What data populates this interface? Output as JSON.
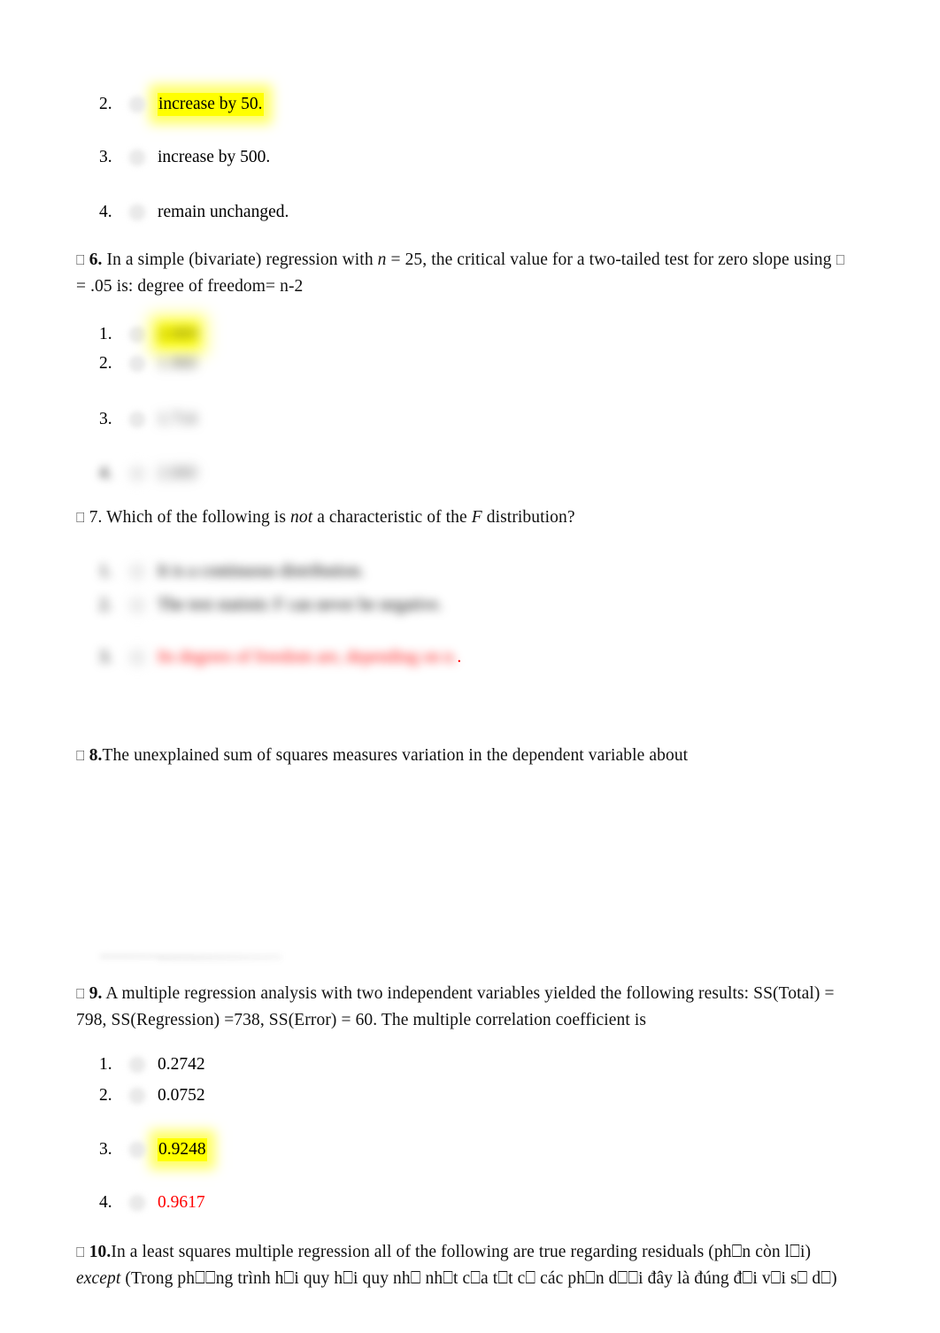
{
  "document": {
    "type": "quiz-worksheet",
    "highlight_color": "#FFFF00",
    "answer_red_color": "#FF0000",
    "tofu_glyph": "⎕"
  },
  "q5_options": {
    "items": [
      {
        "num": "2.",
        "label": "increase by 50.",
        "highlighted": true,
        "redacted": false
      },
      {
        "num": "3.",
        "label": "increase by 500.",
        "highlighted": false,
        "redacted": false
      },
      {
        "num": "4.",
        "label": "remain unchanged.",
        "highlighted": false,
        "redacted": false
      }
    ]
  },
  "q6": {
    "bullet": "⎕",
    "number": "6.",
    "text_part1": " In a simple (bivariate) regression with ",
    "italic_n": "n",
    "text_part2": " = 25, the critical value for a two-tailed test for zero slope using ",
    "alpha_glyph": "⎕",
    "text_line2": " = .05 is: degree of freedom= n-2",
    "options": [
      {
        "num": "1.",
        "label": "2.069",
        "highlighted": true,
        "redacted": true
      },
      {
        "num": "2.",
        "label": "1.960",
        "highlighted": false,
        "redacted": true
      },
      {
        "num": "3.",
        "label": "1.714",
        "highlighted": false,
        "redacted": true
      },
      {
        "num": "4.",
        "label": "2.060",
        "highlighted": false,
        "redacted": true
      }
    ]
  },
  "q7": {
    "bullet": "⎕",
    "number": "7.",
    "text_part1": " Which of the following is ",
    "italic_not": "not",
    "text_part2": " a characteristic of the ",
    "italic_F": "F",
    "text_part3": " distribution?",
    "options": [
      {
        "num": "1.",
        "label": "It is a continuous distribution.",
        "redacted": true,
        "red": false
      },
      {
        "num": "2.",
        "label": "The test statistic F can never be negative.",
        "redacted": true,
        "red": false
      },
      {
        "num": "3.",
        "label": "Its degrees of freedom are, depending on n.",
        "redacted": true,
        "red": true,
        "trailing_period": "."
      }
    ]
  },
  "q8": {
    "bullet": "⎕",
    "number": "8.",
    "text": "The unexplained sum of squares measures variation in the dependent variable about"
  },
  "q9": {
    "bullet": "⎕",
    "number": "9.",
    "text_line1": " A multiple regression analysis with two independent variables yielded the following results: SS(Total) =",
    "text_line2": "798, SS(Regression) =738, SS(Error) = 60. The multiple correlation coefficient is",
    "options": [
      {
        "num": "1.",
        "label": "0.2742",
        "highlighted": false,
        "red": false
      },
      {
        "num": "2.",
        "label": "0.0752",
        "highlighted": false,
        "red": false
      },
      {
        "num": "3.",
        "label": "0.9248",
        "highlighted": true,
        "red": false
      },
      {
        "num": "4.",
        "label": "0.9617",
        "highlighted": false,
        "red": true
      }
    ]
  },
  "q10": {
    "bullet": "⎕",
    "number": "10.",
    "text_line1": "In a least squares multiple regression all of the following are true regarding residuals (ph⎕n còn l⎕i)",
    "italic_except": "except",
    "text_line2": " (Trong ph⎕⎕ng trình h⎕i quy h⎕i quy nh⎕ nh⎕t c⎕a t⎕t c⎕ các ph⎕n d⎕⎕i đây là đúng đ⎕i v⎕i s⎕ d⎕)"
  }
}
